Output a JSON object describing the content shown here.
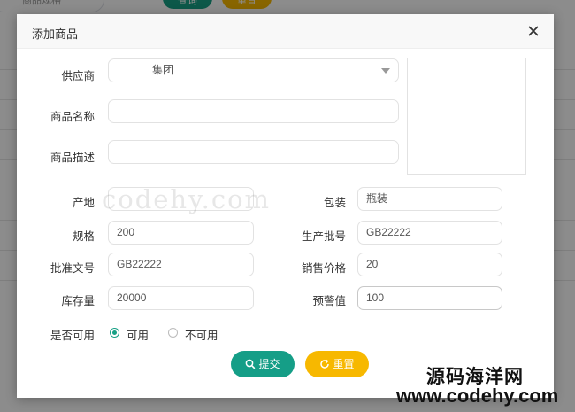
{
  "background": {
    "search_placeholder": "商品规格",
    "query_label": "查询",
    "reset_label": "重置"
  },
  "dialog": {
    "title": "添加商品",
    "fields": {
      "supplier": {
        "label": "供应商",
        "value": "集团"
      },
      "name": {
        "label": "商品名称",
        "value": ""
      },
      "description": {
        "label": "商品描述",
        "value": ""
      },
      "origin": {
        "label": "产地",
        "value": ""
      },
      "packaging": {
        "label": "包装",
        "value": "瓶装"
      },
      "spec": {
        "label": "规格",
        "value": "200"
      },
      "batch": {
        "label": "生产批号",
        "value": "GB22222"
      },
      "approval": {
        "label": "批准文号",
        "value": "GB22222"
      },
      "price": {
        "label": "销售价格",
        "value": "20"
      },
      "stock": {
        "label": "库存量",
        "value": "20000"
      },
      "warning": {
        "label": "预警值",
        "value": "100"
      }
    },
    "availability": {
      "label": "是否可用",
      "options": [
        "可用",
        "不可用"
      ],
      "selected": "可用"
    },
    "submit_label": "提交",
    "reset_label": "重置"
  },
  "watermark": "codehy.com",
  "brand": {
    "name": "源码海洋网",
    "url": "www.codehy.com"
  },
  "colors": {
    "primary": "#159e87",
    "warning": "#f7b800"
  }
}
